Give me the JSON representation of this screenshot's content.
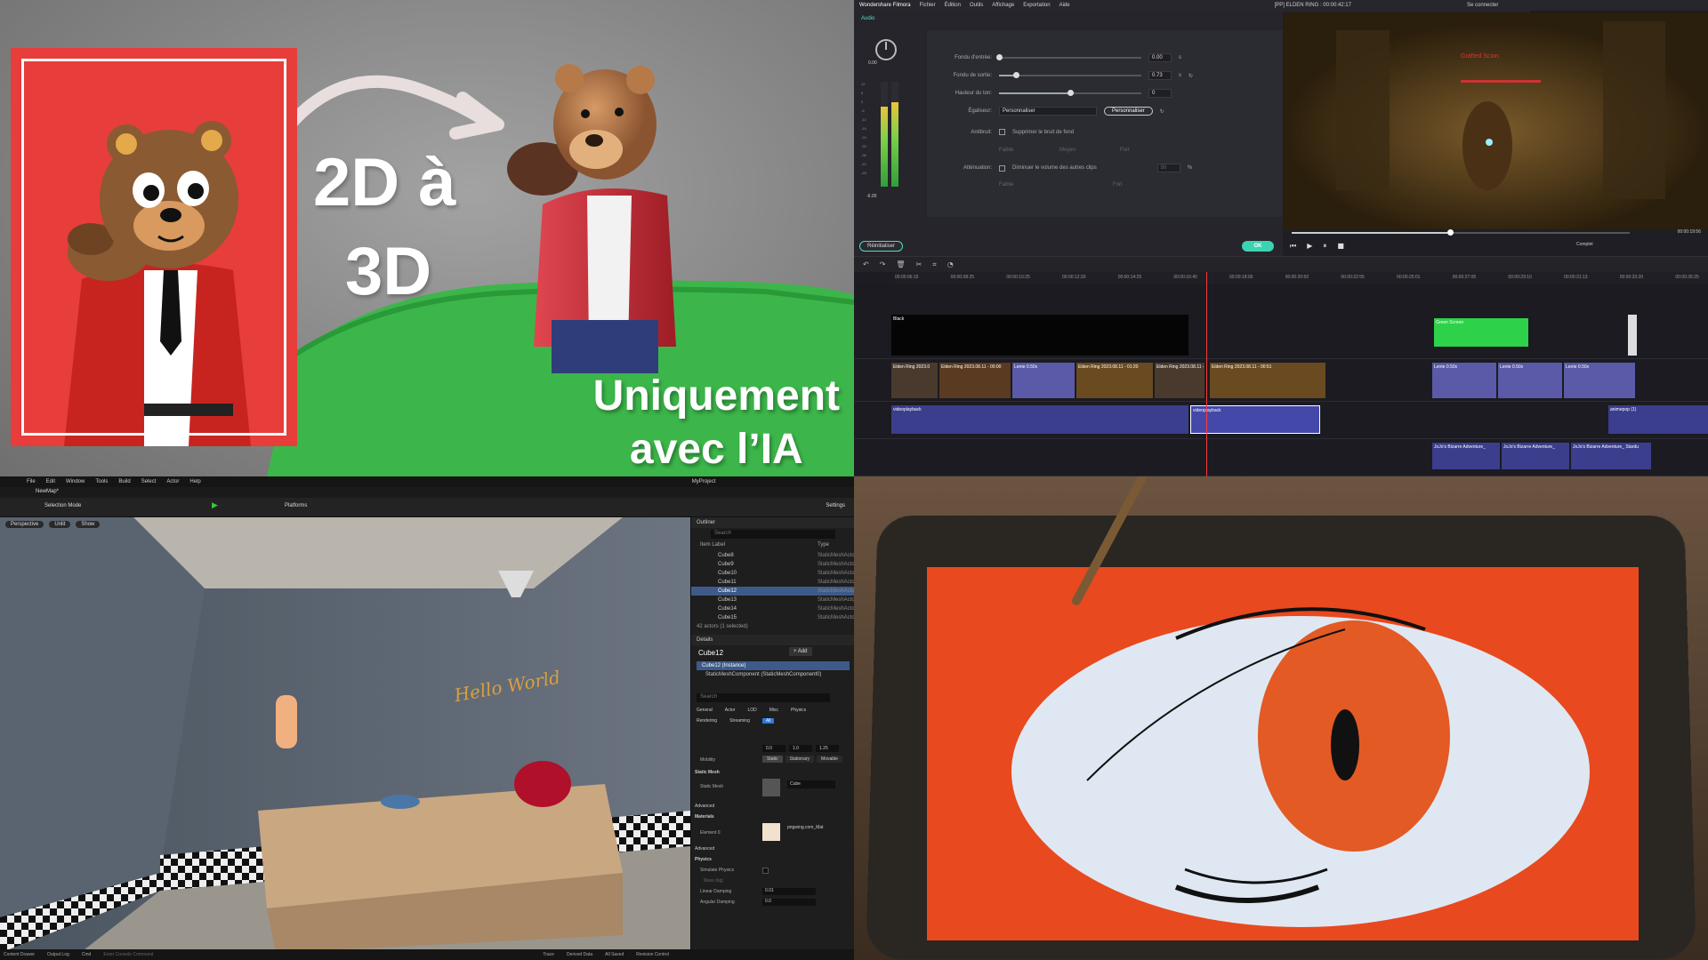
{
  "quadrants": {
    "q1": {
      "headline_line1": "2D à",
      "headline_line2": "3D",
      "subline1": "Uniquement",
      "subline2": "avec l’IA",
      "colors": {
        "card_red": "#e73d3b",
        "grass": "#3bb548"
      }
    },
    "q2": {
      "app_title": "Wondershare Filmora",
      "menu": [
        "Fichier",
        "Édition",
        "Outils",
        "Affichage",
        "Exportation",
        "Aide"
      ],
      "project_title": "[PP] ELDEN RING : 00:00:42:17",
      "login": "Se connecter",
      "tab_audio": "Audio",
      "meter_top": "0.00",
      "meter_bottom": "-6.00",
      "meter_scale": [
        "12",
        "6",
        "0",
        "-6",
        "-12",
        "-18",
        "-24",
        "-30",
        "-36",
        "-42",
        "-48"
      ],
      "rows": [
        {
          "label": "Fondu d'entrée:",
          "value": "0.00",
          "unit": "s",
          "level": 0.0
        },
        {
          "label": "Fondu de sortie:",
          "value": "0.73",
          "unit": "s",
          "level": 0.12
        },
        {
          "label": "Hauteur du ton:",
          "value": "0",
          "unit": "",
          "level": 0.5
        }
      ],
      "equalizer_label": "Égaliseur:",
      "equalizer_value": "Personnaliser",
      "equalizer_button": "Personnaliser",
      "denoise_label": "Antibruit:",
      "denoise_checkbox": "Supprimer le bruit de fond",
      "denoise_scale": [
        "Faible",
        "Moyen",
        "Fort"
      ],
      "duck_label": "Atténuation:",
      "duck_checkbox": "Diminuer le volume des autres clips",
      "duck_value": "50",
      "duck_unit": "%",
      "duck_scale": [
        "Faible",
        "Fort"
      ],
      "reset_button": "Réinitialiser",
      "ok_button": "OK",
      "preview_time": "00:00:19:56",
      "preview_quality": "Complet",
      "game_hud_text": "Grafted Scion",
      "timeline_ticks": [
        "00:00:06:15",
        "00:00:08:25",
        "00:00:10:25",
        "00:00:12:20",
        "00:00:14:25",
        "00:00:16:40",
        "00:00:18:00",
        "00:00:20:50",
        "00:00:22:55",
        "00:00:25:01",
        "00:00:27:05",
        "00:00:29:10",
        "00:00:31:13",
        "00:00:33:20",
        "00:00:35:25"
      ],
      "clips": {
        "black": "Black",
        "green": "Green Screen",
        "video": [
          "Elden Ring 2023.0",
          "Elden Ring 2023.08.11 - 00:00",
          "Lente 0.50x",
          "Elden Ring 2023.08.11 - 01:20",
          "Elden Ring 2023.08.11 - 01:23",
          "Elden Ring 2023.08.11 - 00:51",
          "Lente 0.50x",
          "Lente 0.50x",
          "Lente 0.50x"
        ],
        "audio1": "videoplayback",
        "audio2": "videoplayback",
        "audio3": "animepop (1)",
        "music": [
          "JoJo's Bizarre Adventure_",
          "JoJo's Bizarre Adventure_",
          "JoJo's Bizarre Adventure_ Stardu"
        ]
      }
    },
    "q3": {
      "menu": [
        "File",
        "Edit",
        "Window",
        "Tools",
        "Build",
        "Select",
        "Actor",
        "Help"
      ],
      "project": "MyProject",
      "map_tab": "NewMap*",
      "mode": "Selection Mode",
      "platforms": "Platforms",
      "settings": "Settings",
      "viewport_buttons": [
        "Perspective",
        "Unlit",
        "Show"
      ],
      "outliner_title": "Outliner",
      "search_placeholder": "Search",
      "col_label": "Item Label",
      "col_type": "Type",
      "outliner_items": [
        {
          "name": "Cube8",
          "type": "StaticMeshActor"
        },
        {
          "name": "Cube9",
          "type": "StaticMeshActor"
        },
        {
          "name": "Cube10",
          "type": "StaticMeshActor"
        },
        {
          "name": "Cube11",
          "type": "StaticMeshActor"
        },
        {
          "name": "Cube12",
          "type": "StaticMeshActor",
          "selected": true
        },
        {
          "name": "Cube13",
          "type": "StaticMeshActor"
        },
        {
          "name": "Cube14",
          "type": "StaticMeshActor"
        },
        {
          "name": "Cube15",
          "type": "StaticMeshActor"
        }
      ],
      "actors_count": "42 actors (1 selected)",
      "details_title": "Details",
      "selected_actor": "Cube12",
      "add_button": "+ Add",
      "instance_row": "Cube12 (Instance)",
      "component_row": "StaticMeshComponent (StaticMeshComponent0)",
      "details_tabs1": [
        "General",
        "Actor",
        "LOD",
        "Misc",
        "Physics"
      ],
      "details_tabs2": [
        "Rendering",
        "Streaming",
        "All"
      ],
      "scale_values": [
        "0.0",
        "1.0",
        "1.25"
      ],
      "mobility_label": "Mobility",
      "mobility": [
        "Static",
        "Stationary",
        "Movable"
      ],
      "sec_static_mesh": "Static Mesh",
      "static_mesh_label": "Static Mesh",
      "static_mesh_value": "Cube",
      "sec_advanced": "Advanced",
      "sec_materials": "Materials",
      "element_label": "Element 0",
      "material_value": "pngwing.com_Mat",
      "sec_physics": "Physics",
      "simulate_physics": "Simulate Physics",
      "mass_label": "Mass (kg)",
      "linear_damping": "Linear Damping",
      "linear_damping_value": "0.01",
      "angular_damping": "Angular Damping",
      "angular_damping_value": "0.0",
      "bottom_bar": [
        "Content Drawer",
        "Output Log",
        "Cmd",
        "Enter Console Command",
        "Trace",
        "Derived Data",
        "All Saved",
        "Revision Control"
      ],
      "wall_text": "Hello World"
    },
    "q4": {}
  }
}
